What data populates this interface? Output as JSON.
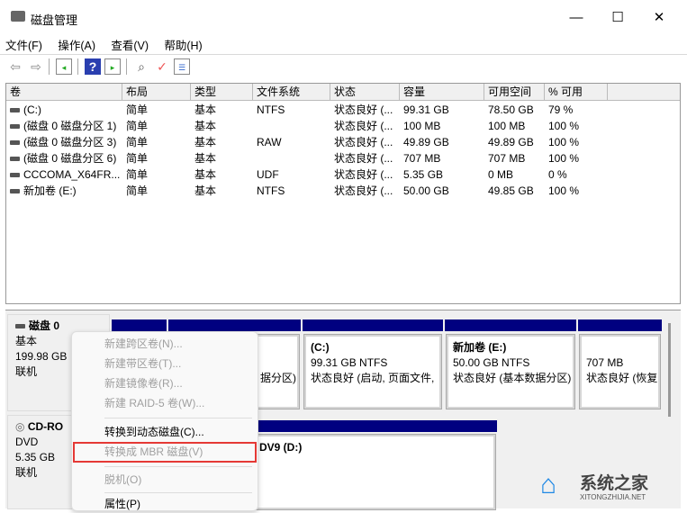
{
  "window": {
    "title": "磁盘管理",
    "minimize": "—",
    "maximize": "☐",
    "close": "✕"
  },
  "menu": [
    "文件(F)",
    "操作(A)",
    "查看(V)",
    "帮助(H)"
  ],
  "toolbar": [
    "back-icon",
    "forward-icon",
    "console-tree-icon",
    "help-icon",
    "action-pane-icon",
    "connect-icon",
    "check-icon",
    "properties-icon"
  ],
  "table": {
    "columns": [
      "卷",
      "布局",
      "类型",
      "文件系统",
      "状态",
      "容量",
      "可用空间",
      "% 可用"
    ],
    "rows": [
      [
        "(C:)",
        "简单",
        "基本",
        "NTFS",
        "状态良好 (...",
        "99.31 GB",
        "78.50 GB",
        "79 %"
      ],
      [
        "(磁盘 0 磁盘分区 1)",
        "简单",
        "基本",
        "",
        "状态良好 (...",
        "100 MB",
        "100 MB",
        "100 %"
      ],
      [
        "(磁盘 0 磁盘分区 3)",
        "简单",
        "基本",
        "RAW",
        "状态良好 (...",
        "49.89 GB",
        "49.89 GB",
        "100 %"
      ],
      [
        "(磁盘 0 磁盘分区 6)",
        "简单",
        "基本",
        "",
        "状态良好 (...",
        "707 MB",
        "707 MB",
        "100 %"
      ],
      [
        "CCCOMA_X64FR...",
        "简单",
        "基本",
        "UDF",
        "状态良好 (...",
        "5.35 GB",
        "0 MB",
        "0 %"
      ],
      [
        "新加卷 (E:)",
        "简单",
        "基本",
        "NTFS",
        "状态良好 (...",
        "50.00 GB",
        "49.85 GB",
        "100 %"
      ]
    ]
  },
  "disks": [
    {
      "name": "磁盘 0",
      "type": "基本",
      "size": "199.98 GB",
      "status": "联机"
    },
    {
      "name": "CD-RO",
      "type": "DVD",
      "size": "5.35 GB",
      "status": "联机"
    }
  ],
  "partitions": {
    "p2": {
      "l3": "据分区)"
    },
    "c": {
      "name": "(C:)",
      "size": "99.31 GB NTFS",
      "status": "状态良好 (启动, 页面文件,"
    },
    "e": {
      "name": "新加卷  (E:)",
      "size": "50.00 GB NTFS",
      "status": "状态良好 (基本数据分区)"
    },
    "r": {
      "size": "707 MB",
      "status": "状态良好 (恢复"
    },
    "d": {
      "name": "DV9  (D:)"
    }
  },
  "context_menu": {
    "items": [
      {
        "label": "新建跨区卷(N)...",
        "enabled": false
      },
      {
        "label": "新建带区卷(T)...",
        "enabled": false
      },
      {
        "label": "新建镜像卷(R)...",
        "enabled": false
      },
      {
        "label": "新建 RAID-5 卷(W)...",
        "enabled": false
      },
      {
        "label": "转换到动态磁盘(C)...",
        "enabled": true
      },
      {
        "label": "转换成 MBR 磁盘(V)",
        "enabled": false,
        "highlighted": true
      },
      {
        "label": "脱机(O)",
        "enabled": false
      },
      {
        "label": "属性(P)",
        "enabled": true
      }
    ],
    "highlight_color": "#e53935"
  },
  "watermark": {
    "text": "系统之家",
    "url_text": "XITONGZHIJIA.NET"
  },
  "colors": {
    "partition_bar": "#000080"
  }
}
